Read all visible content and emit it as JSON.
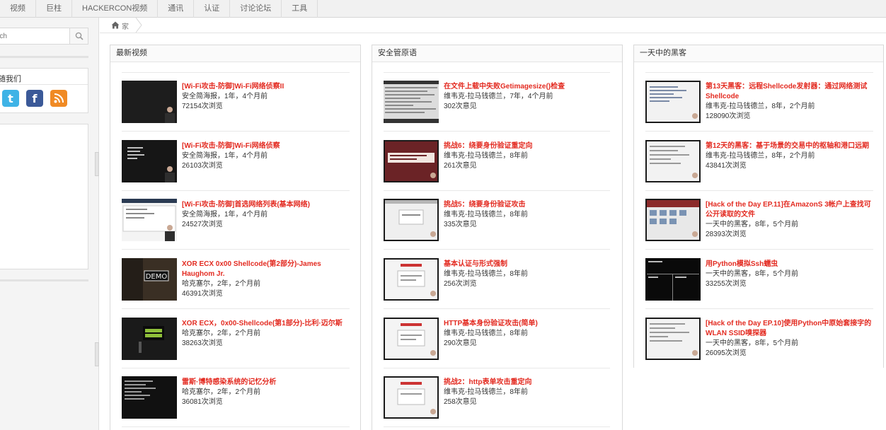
{
  "nav": {
    "items": [
      "视频",
      "巨柱",
      "HACKERCON视频",
      "通讯",
      "认证",
      "讨论论坛",
      "工具"
    ]
  },
  "sidebar": {
    "search_placeholder": "rch",
    "follow_label": "随我们"
  },
  "breadcrumb": {
    "home": "家"
  },
  "columns": [
    {
      "title": "最新视频",
      "items": [
        {
          "title": "[Wi-Fi攻击-防御]Wi-Fi网络侦察II",
          "author": "安全简海报，1年，4个月前",
          "views": "72154次浏览"
        },
        {
          "title": "[Wi-Fi攻击-防御]Wi-Fi网络侦察",
          "author": "安全简海报，1年，4个月前",
          "views": "26103次浏览"
        },
        {
          "title": "[Wi-Fi攻击-防御]首选网络列表(基本网络)",
          "author": "安全简海报，1年，4个月前",
          "views": "24527次浏览"
        },
        {
          "title": "XOR ECX 0x00 Shellcode(第2部分)-James Haughom Jr.",
          "author": "哈克塞尔，2年，2个月前",
          "views": "46391次浏览"
        },
        {
          "title": "XOR ECX，0x00-Shellcode(第1部分)-比利·迈尔斯",
          "author": "哈克塞尔，2年，2个月前",
          "views": "38263次浏览"
        },
        {
          "title": "雷斯·博特感染系统的记忆分析",
          "author": "哈克塞尔，2年，2个月前",
          "views": "36081次浏览"
        }
      ]
    },
    {
      "title": "安全管原语",
      "items": [
        {
          "title": "在文件上载中失败Getimagesize()检查",
          "author": "维韦克-拉马钱德兰，7年，4个月前",
          "views": "302次意见"
        },
        {
          "title": "挑战6：绕要身份验证重定向",
          "author": "维韦克-拉马钱德兰，8年前",
          "views": "261次意见"
        },
        {
          "title": "挑战5：绕要身份验证攻击",
          "author": "维韦克-拉马钱德兰，8年前",
          "views": "335次意见"
        },
        {
          "title": "基本认证与形式强制",
          "author": "维韦克-拉马钱德兰，8年前",
          "views": "256次浏览"
        },
        {
          "title": "HTTP基本身份验证攻击(简单)",
          "author": "维韦克-拉马钱德兰，8年前",
          "views": "290次意见"
        },
        {
          "title": "挑战2：http表单攻击重定向",
          "author": "维韦克-拉马钱德兰，8年前",
          "views": "258次意见"
        }
      ]
    },
    {
      "title": "一天中的黑客",
      "items": [
        {
          "title": "第13天黑客：远程Shellcode发射器：通过网络测试Shellcode",
          "author": "维韦克-拉马钱德兰，8年，2个月前",
          "views": "128090次浏览"
        },
        {
          "title": "第12天的黑客：基于场景的交易中的枢轴和港口远期",
          "author": "维韦克-拉马钱德兰，8年，2个月前",
          "views": "43841次浏览"
        },
        {
          "title": "[Hack of the Day EP.11]在AmazonS 3帐户上查找可公开读取的文件",
          "author": "一天中的黑客，8年，5个月前",
          "views": "28393次浏览"
        },
        {
          "title": "用Python模拟Ssh蠕虫",
          "author": "一天中的黑客，8年，5个月前",
          "views": "33255次浏览"
        },
        {
          "title": "[Hack of the Day EP.10]使用Python中原始套接字的WLAN SSID嗅探器",
          "author": "一天中的黑客，8年，5个月前",
          "views": "26095次浏览"
        }
      ]
    }
  ]
}
